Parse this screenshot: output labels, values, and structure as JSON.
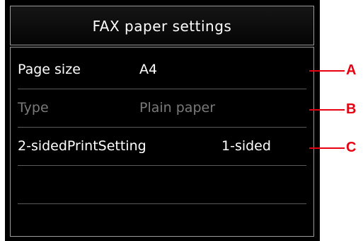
{
  "title": "FAX paper settings",
  "rows": [
    {
      "label": "Page size",
      "value": "A4",
      "enabled": true
    },
    {
      "label": "Type",
      "value": "Plain paper",
      "enabled": false
    },
    {
      "label": "2-sidedPrintSetting",
      "value": "1-sided",
      "enabled": true
    }
  ],
  "callouts": [
    "A",
    "B",
    "C"
  ],
  "colors": {
    "screen_bg": "#000000",
    "text": "#ffffff",
    "disabled_text": "#7a7a7a",
    "callout": "#e60012"
  }
}
